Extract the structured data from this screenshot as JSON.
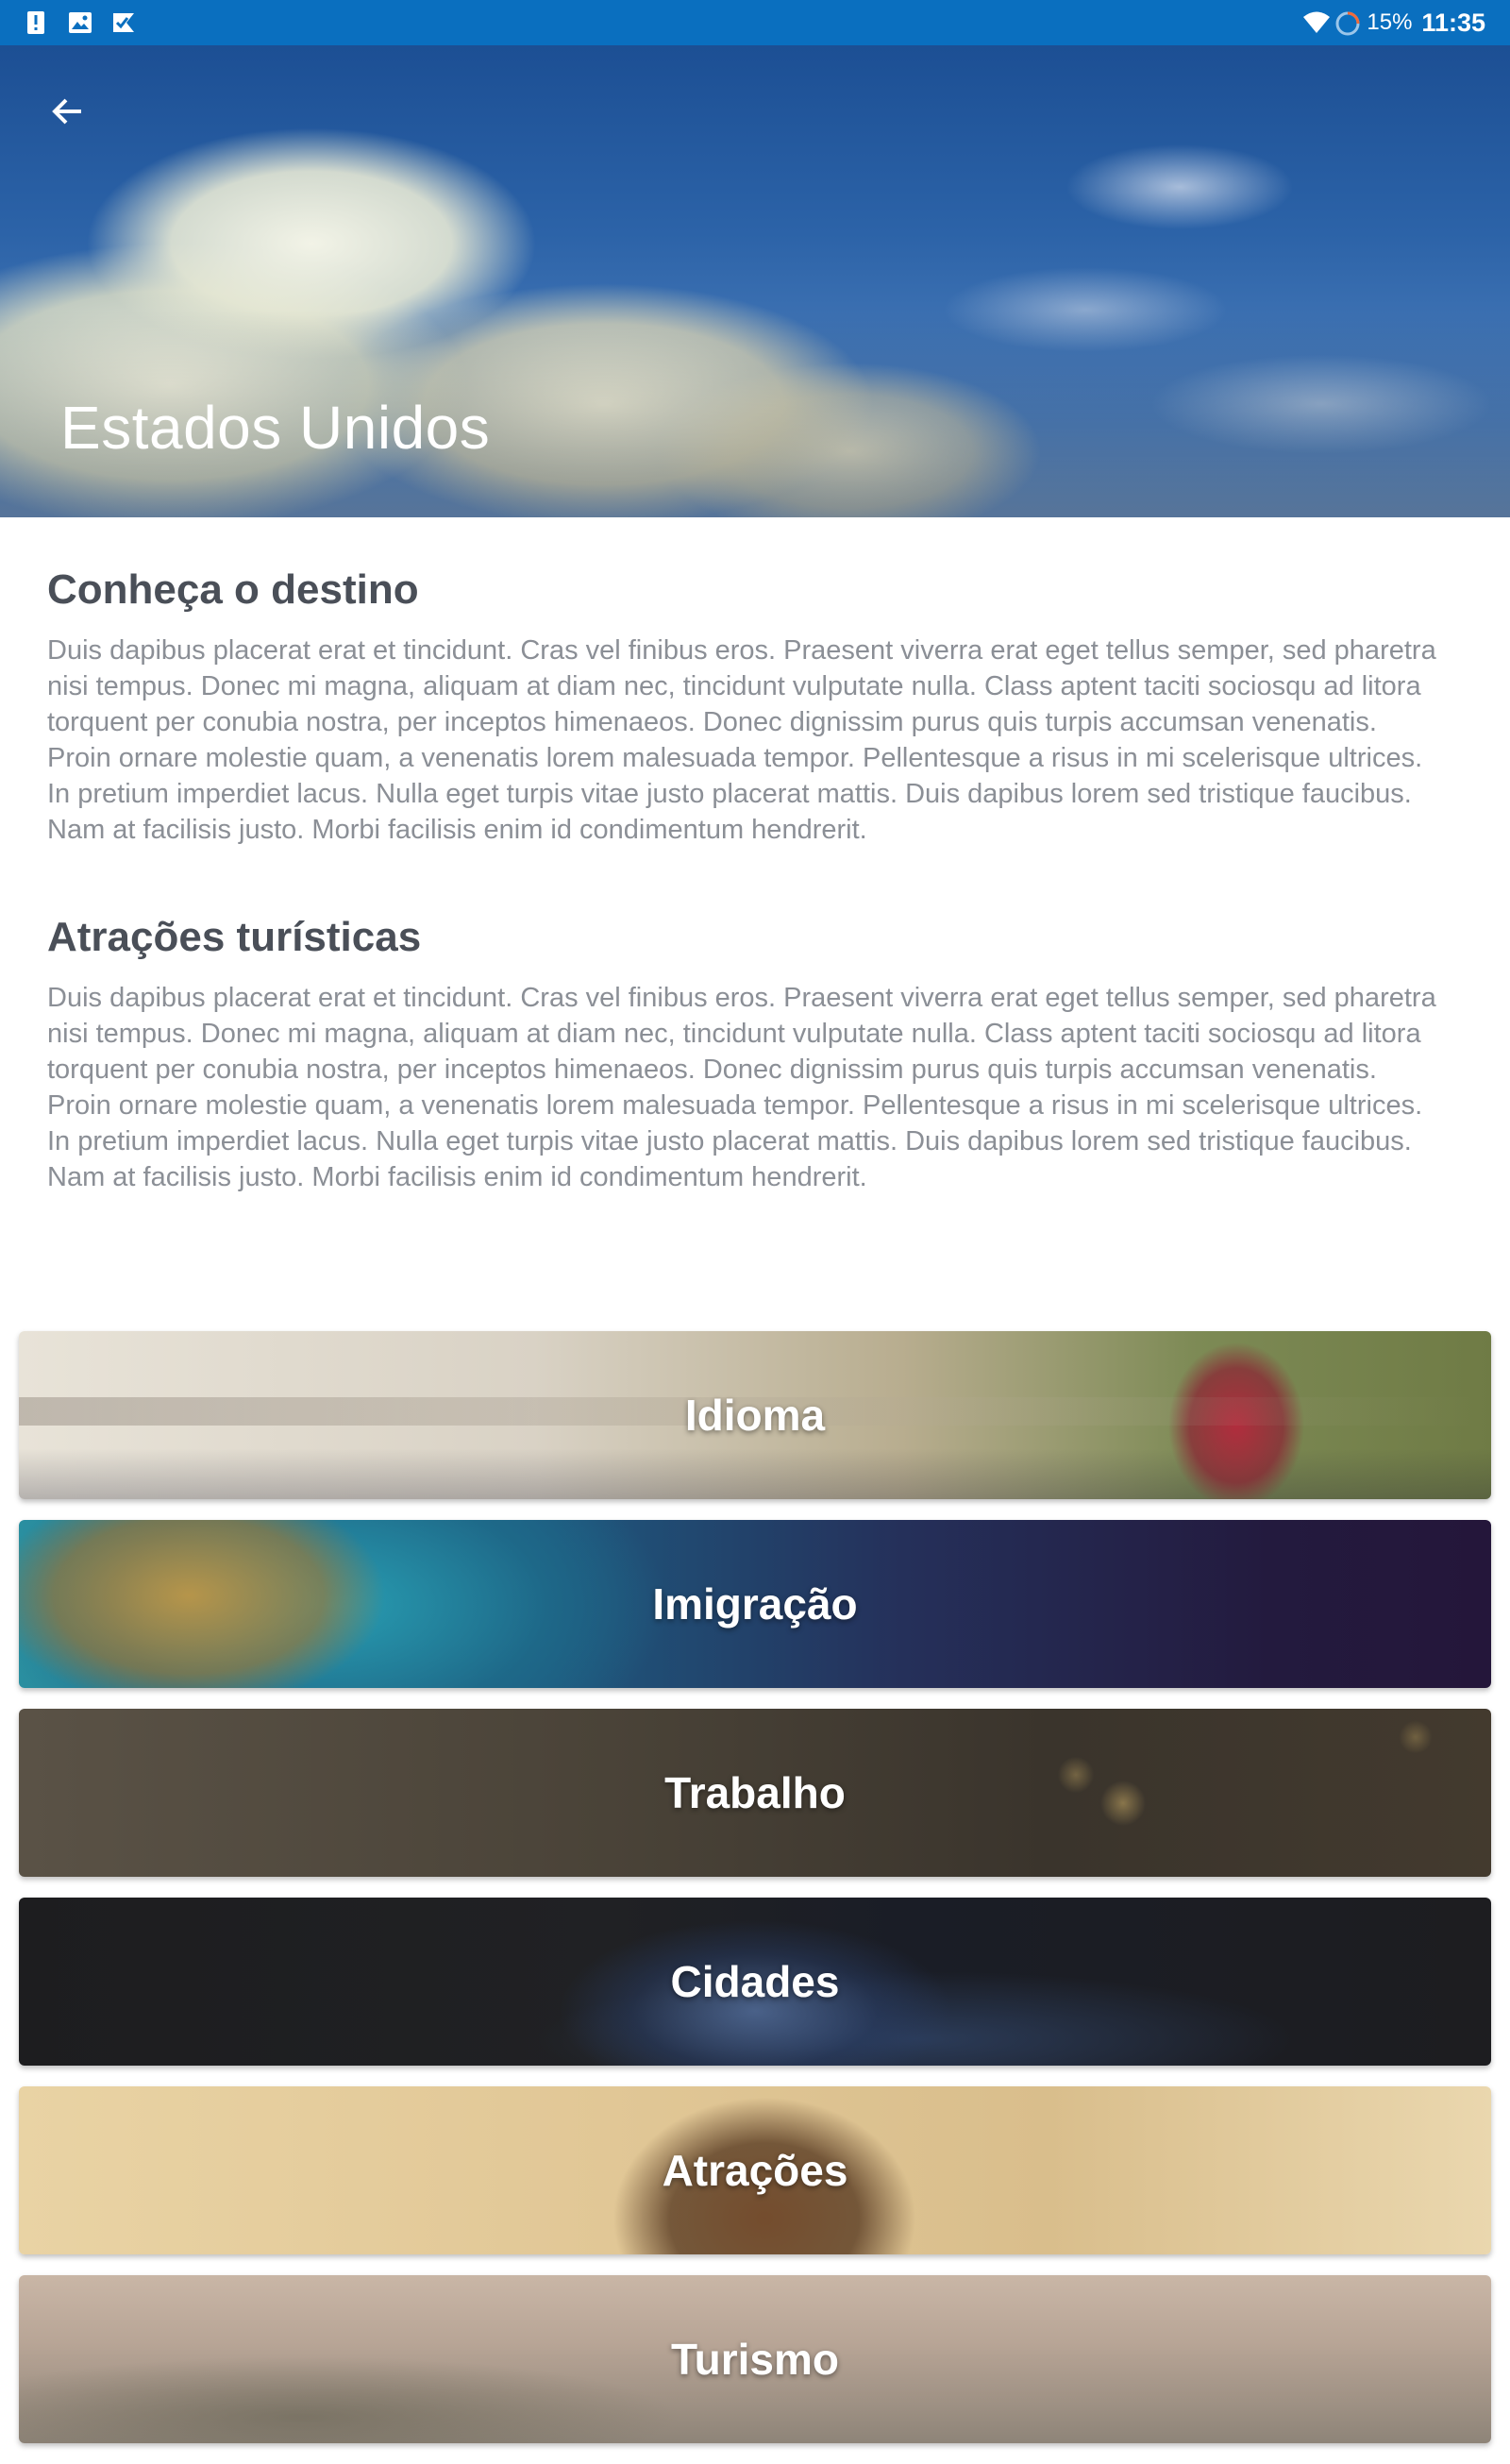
{
  "status_bar": {
    "battery_text": "15%",
    "time": "11:35",
    "icons": [
      "alert-icon",
      "image-icon",
      "check-badge-icon",
      "wifi-icon",
      "sync-icon"
    ]
  },
  "hero": {
    "title": "Estados Unidos",
    "back_icon": "arrow-left-icon"
  },
  "sections": [
    {
      "title": "Conheça o destino",
      "body": "Duis dapibus placerat erat et tincidunt. Cras vel finibus eros. Praesent viverra erat eget tellus semper, sed pharetra nisi tempus. Donec mi magna, aliquam at diam nec, tincidunt vulputate nulla. Class aptent taciti sociosqu ad litora torquent per conubia nostra, per inceptos himenaeos. Donec dignissim purus quis turpis accumsan venenatis. Proin ornare molestie quam, a venenatis lorem malesuada tempor. Pellentesque a risus in mi scelerisque ultrices. In pretium imperdiet lacus. Nulla eget turpis vitae justo placerat mattis. Duis dapibus lorem sed tristique faucibus. Nam at facilisis justo. Morbi facilisis enim id condimentum hendrerit."
    },
    {
      "title": "Atrações turísticas",
      "body": "Duis dapibus placerat erat et tincidunt. Cras vel finibus eros. Praesent viverra erat eget tellus semper, sed pharetra nisi tempus. Donec mi magna, aliquam at diam nec, tincidunt vulputate nulla. Class aptent taciti sociosqu ad litora torquent per conubia nostra, per inceptos himenaeos. Donec dignissim purus quis turpis accumsan venenatis. Proin ornare molestie quam, a venenatis lorem malesuada tempor. Pellentesque a risus in mi scelerisque ultrices. In pretium imperdiet lacus. Nulla eget turpis vitae justo placerat mattis. Duis dapibus lorem sed tristique faucibus. Nam at facilisis justo. Morbi facilisis enim id condimentum hendrerit."
    }
  ],
  "cards": [
    {
      "label": "Idioma"
    },
    {
      "label": "Imigração"
    },
    {
      "label": "Trabalho"
    },
    {
      "label": "Cidades"
    },
    {
      "label": "Atrações"
    },
    {
      "label": "Turismo"
    }
  ],
  "colors": {
    "status_bar": "#0a6fbf",
    "heading": "#4a4f58",
    "body_text": "#8b8f96"
  }
}
